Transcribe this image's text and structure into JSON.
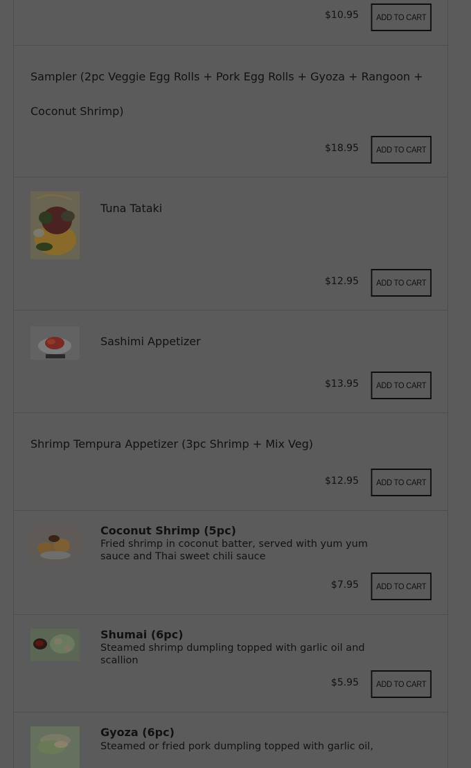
{
  "add_to_cart_label": "ADD TO CART",
  "items": [
    {
      "name": "",
      "price": "$10.95"
    },
    {
      "name": "Sampler (2pc Veggie Egg Rolls + Pork Egg Rolls + Gyoza + Rangoon + Coconut Shrimp)",
      "price": "$18.95"
    },
    {
      "name": "Tuna Tataki",
      "price": "$12.95"
    },
    {
      "name": "Sashimi Appetizer",
      "price": "$13.95"
    },
    {
      "name": "Shrimp Tempura Appetizer (3pc Shrimp + Mix Veg)",
      "price": "$12.95"
    },
    {
      "name": "Coconut Shrimp (5pc)",
      "description": "Fried shrimp in coconut batter, served with yum yum sauce and Thai sweet chili sauce",
      "price": "$7.95"
    },
    {
      "name": "Shumai (6pc)",
      "description": "Steamed shrimp dumpling topped with garlic oil and scallion",
      "price": "$5.95"
    },
    {
      "name": "Gyoza (6pc)",
      "description": "Steamed or fried pork dumpling topped with garlic oil,"
    }
  ],
  "colors": {
    "overlay_bg": "#5b5b5b",
    "text": "#111111",
    "button_border": "#0e0e0e"
  }
}
